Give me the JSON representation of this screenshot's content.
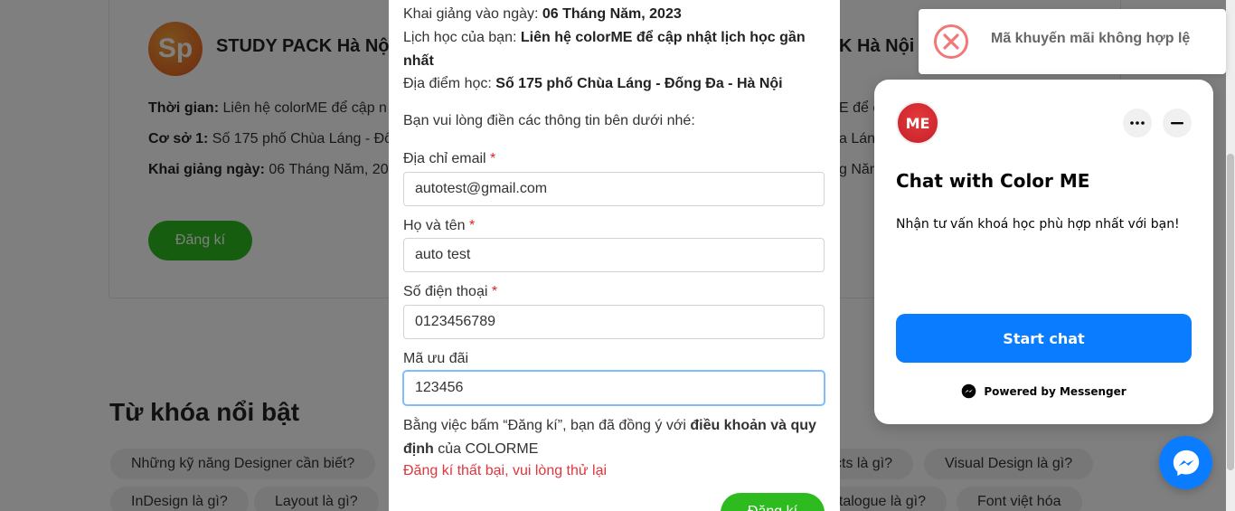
{
  "background": {
    "card": {
      "logo_text": "Sp",
      "title": "STUDY PACK Hà Nội",
      "title_right": "K Hà Nội -",
      "time_label": "Thời gian:",
      "time_value": "Liên hệ colorME để cập n",
      "time_right": "E để c",
      "campus_label": "Cơ sở 1:",
      "campus_value": "Số 175 phố Chùa Láng - Đố",
      "campus_right": "a Láng",
      "start_label": "Khai giảng ngày:",
      "start_value": "06 Tháng Năm, 20",
      "start_right": "g Năm",
      "register_label": "Đăng kí"
    },
    "keywords_title": "Từ khóa nổi bật",
    "keywords": [
      "Những kỹ năng Designer cần biết?",
      "cts là gì?",
      "Visual Design là gì?",
      "InDesign là gì?",
      "Layout là gì?",
      "atalogue là gì?",
      "Font việt hóa"
    ]
  },
  "modal": {
    "start_date_label": "Khai giảng vào ngày:",
    "start_date_value": "06 Tháng Năm, 2023",
    "schedule_label": "Lịch học của bạn:",
    "schedule_value": "Liên hệ colorME để cập nhật lịch học gần nhất",
    "location_label": "Địa điểm học:",
    "location_value": "Số 175 phố Chùa Láng - Đống Đa - Hà Nội",
    "instruction": "Bạn vui lòng điền các thông tin bên dưới nhé:",
    "required_mark": "*",
    "email_label": "Địa chỉ email",
    "email_value": "autotest@gmail.com",
    "name_label": "Họ và tên",
    "name_value": "auto test",
    "phone_label": "Số điện thoại",
    "phone_value": "0123456789",
    "promo_label": "Mã ưu đãi",
    "promo_value": "123456",
    "terms_prefix": "Bằng việc bấm “Đăng kí”, bạn đã đồng ý với",
    "terms_link": "điều khoản và quy định",
    "terms_suffix": "của COLORME",
    "error_message": "Đăng kí thất bại, vui lòng thử lại",
    "submit_label": "Đăng kí"
  },
  "toast": {
    "icon": "error-x-icon",
    "message": "Mã khuyến mãi không hợp lệ"
  },
  "chat": {
    "avatar_icon": "colorme-logo",
    "avatar_text": "ME",
    "title": "Chat with Color ME",
    "subtitle": "Nhận tư vấn khoá học phù hợp nhất với bạn!",
    "start_label": "Start chat",
    "powered_label": "Powered by Messenger"
  },
  "colors": {
    "primary_green": "#2dbb1f",
    "error_red": "#e0353b",
    "messenger_blue": "#0a7cff"
  }
}
